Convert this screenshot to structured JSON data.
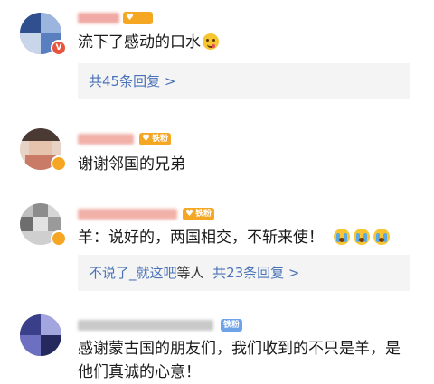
{
  "comments": [
    {
      "name_placeholder": "",
      "fan_badge": "",
      "text": "流下了感动的口水",
      "emoji": "yum-face-icon",
      "replies": {
        "count_text": "共45条回复 >"
      },
      "avatar_colors": [
        "#2f4f8f",
        "#5a7fc1",
        "#9bb5de",
        "#c9d6ea"
      ],
      "badge_color": "#e8553e",
      "badge_label": "V"
    },
    {
      "fan_badge": "铁粉",
      "text": "谢谢邻国的兄弟",
      "avatar_colors": [
        "#c97b67",
        "#7a6a5e",
        "#e6d3c5",
        "#4a3a33"
      ],
      "badge_color": "#f5a623",
      "badge_label": ""
    },
    {
      "fan_badge": "铁粉",
      "text": "羊：说好的，两国相交，不斩来使！",
      "emoji_list": [
        "crying-face-icon",
        "crying-face-icon",
        "crying-face-icon"
      ],
      "replies": {
        "names": "不说了_就这吧",
        "names_suffix": "等人",
        "count_text": "共23条回复 >"
      },
      "avatar_colors": [
        "#bfbfbf",
        "#8c8c8c",
        "#e2e2e2",
        "#6e6e6e"
      ],
      "badge_color": "#f5a623",
      "badge_label": ""
    },
    {
      "fan_badge": "铁粉",
      "text": "感谢蒙古国的朋友们，我们收到的不只是羊，是他们真诚的心意！",
      "avatar_colors": [
        "#3a3f8a",
        "#6d70c0",
        "#a3a5de",
        "#26295e"
      ]
    }
  ],
  "colors": {
    "accent_blue": "#4a72b8",
    "fan_badge_orange": "#f5a623",
    "fan_badge_blue": "#6fa3e8",
    "reply_bg": "#f4f4f4"
  }
}
